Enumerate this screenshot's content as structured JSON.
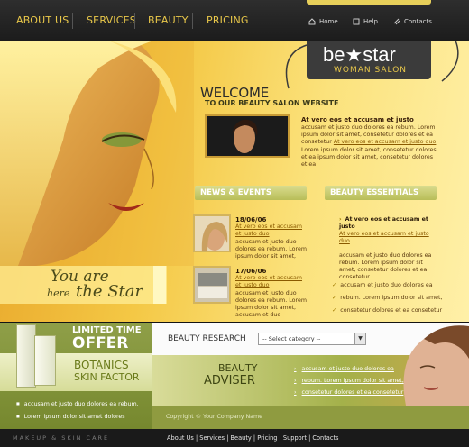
{
  "nav": {
    "items": [
      "ABOUT US",
      "SERVICES",
      "BEAUTY",
      "PRICING"
    ],
    "utility": [
      "Home",
      "Help",
      "Contacts"
    ]
  },
  "brand": {
    "name": "be★star",
    "subtitle": "WOMAN SALON"
  },
  "hero": {
    "tagline_line1": "You are",
    "tagline_here": "here",
    "tagline_line2": "the Star"
  },
  "welcome": {
    "title": "WELCOME",
    "subtitle": "TO OUR BEAUTY SALON WEBSITE",
    "intro_title": "At vero eos et accusam et justo",
    "intro_text1": "accusam et justo duo dolores ea rebum. Lorem ipsum dolor sit amet, consetetur dolores et ea consetetur",
    "intro_link": "At vero eos et accusam et justo duo",
    "intro_text2": "Lorem ipsum dolor sit amet, consetetur dolores et ea ipsum dolor sit amet, consetetur dolores et ea"
  },
  "news": {
    "heading": "NEWS & EVENTS",
    "items": [
      {
        "date": "18/06/06",
        "link": "At vero eos et accusam et justo duo",
        "text": "accusam et justo duo dolores ea rebum. Lorem ipsum dolor sit amet,"
      },
      {
        "date": "17/06/06",
        "link": "At vero eos et accusam et justo duo",
        "text": "accusam et justo duo dolores ea rebum. Lorem ipsum dolor sit amet, accusam et duo"
      }
    ]
  },
  "essentials": {
    "heading": "BEAUTY ESSENTIALS",
    "block1_title": "At vero eos et accusam et justo",
    "block1_link": "At vero eos et accusam et justo duo",
    "block1_text": "accusam et justo duo dolores ea rebum. Lorem ipsum dolor sit amet, consetetur dolores et ea consetetur",
    "checks": [
      "accusam et justo duo dolores ea",
      "rebum. Lorem ipsum dolor sit amet,",
      "consetetur dolores et ea consetetur"
    ]
  },
  "offer": {
    "line1": "LIMITED TIME",
    "line2": "OFFER",
    "brand1": "BOTANICS",
    "brand2": "SKIN FACTOR",
    "bullets": [
      "accusam et justo duo dolores ea rebum.",
      "Lorem ipsum dolor sit amet dolores"
    ]
  },
  "research": {
    "label": "BEAUTY RESEARCH",
    "select_value": "-- Select category --"
  },
  "adviser": {
    "title1": "BEAUTY",
    "title2": "ADVISER",
    "links": [
      "accusam et justo duo dolores ea",
      "rebum. Lorem ipsum dolor sit amet,",
      "consetetur dolores et ea consetetur"
    ]
  },
  "copyright": "Copyright © Your Company Name",
  "footer": {
    "tagline": "MAKEUP & SKIN CARE",
    "links": [
      "About Us",
      "Services",
      "Beauty",
      "Pricing",
      "Support",
      "Contacts"
    ]
  },
  "colors": {
    "nav_bg": "#222222",
    "nav_text": "#e9c84a",
    "hero_yellow": "#f4c845",
    "pill_green": "#c4c86a",
    "olive": "#8f9b40"
  }
}
